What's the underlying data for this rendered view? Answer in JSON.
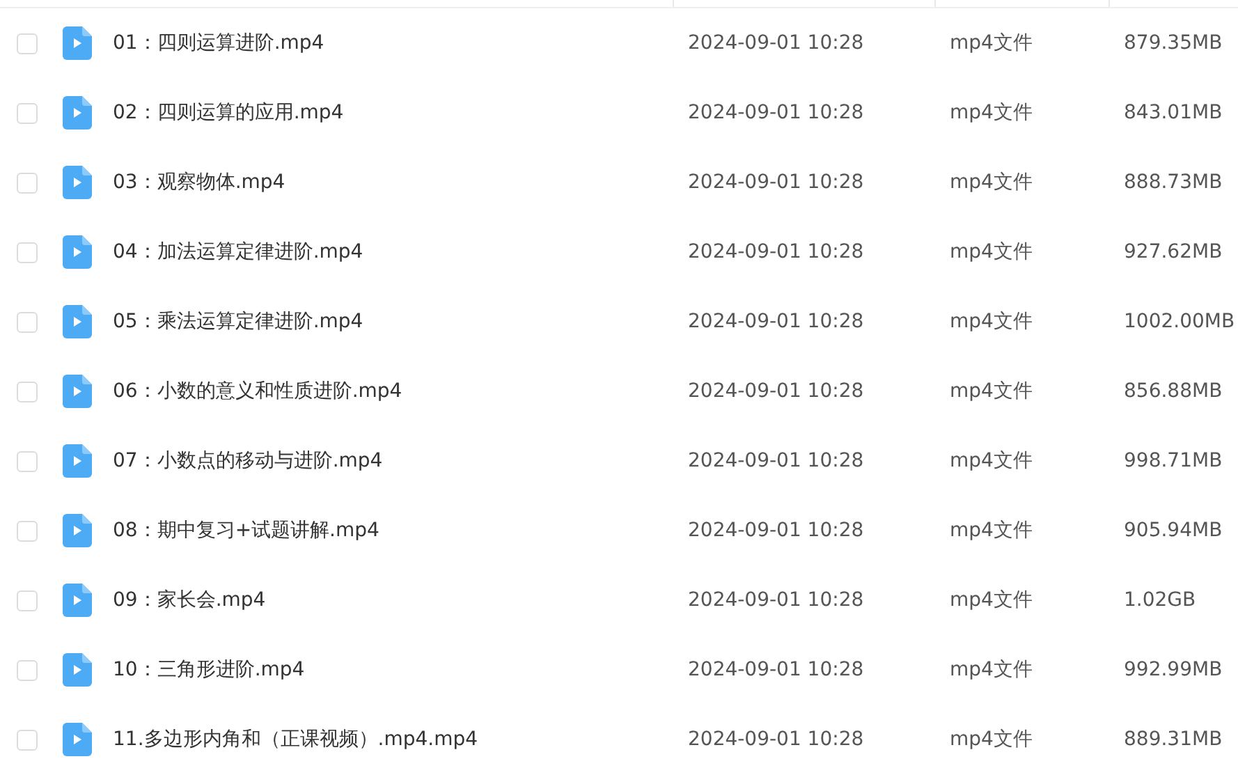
{
  "files": [
    {
      "name": "01：四则运算进阶.mp4",
      "modified": "2024-09-01 10:28",
      "type": "mp4文件",
      "size": "879.35MB",
      "checked": false
    },
    {
      "name": "02：四则运算的应用.mp4",
      "modified": "2024-09-01 10:28",
      "type": "mp4文件",
      "size": "843.01MB",
      "checked": false
    },
    {
      "name": "03：观察物体.mp4",
      "modified": "2024-09-01 10:28",
      "type": "mp4文件",
      "size": "888.73MB",
      "checked": false
    },
    {
      "name": "04：加法运算定律进阶.mp4",
      "modified": "2024-09-01 10:28",
      "type": "mp4文件",
      "size": "927.62MB",
      "checked": false
    },
    {
      "name": "05：乘法运算定律进阶.mp4",
      "modified": "2024-09-01 10:28",
      "type": "mp4文件",
      "size": "1002.00MB",
      "checked": false
    },
    {
      "name": "06：小数的意义和性质进阶.mp4",
      "modified": "2024-09-01 10:28",
      "type": "mp4文件",
      "size": "856.88MB",
      "checked": false
    },
    {
      "name": "07：小数点的移动与进阶.mp4",
      "modified": "2024-09-01 10:28",
      "type": "mp4文件",
      "size": "998.71MB",
      "checked": false
    },
    {
      "name": "08：期中复习+试题讲解.mp4",
      "modified": "2024-09-01 10:28",
      "type": "mp4文件",
      "size": "905.94MB",
      "checked": false
    },
    {
      "name": "09：家长会.mp4",
      "modified": "2024-09-01 10:28",
      "type": "mp4文件",
      "size": "1.02GB",
      "checked": false
    },
    {
      "name": "10：三角形进阶.mp4",
      "modified": "2024-09-01 10:28",
      "type": "mp4文件",
      "size": "992.99MB",
      "checked": false
    },
    {
      "name": "11.多边形内角和（正课视频）.mp4.mp4",
      "modified": "2024-09-01 10:28",
      "type": "mp4文件",
      "size": "889.31MB",
      "checked": false
    }
  ]
}
